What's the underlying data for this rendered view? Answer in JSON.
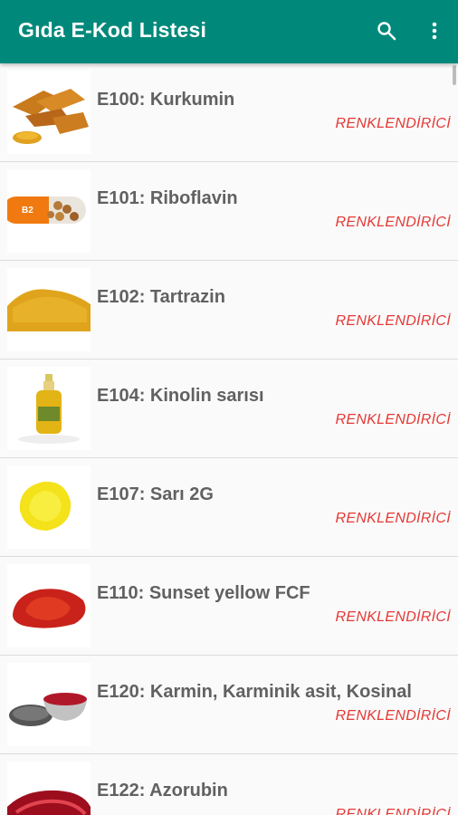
{
  "appbar": {
    "title": "Gıda E-Kod Listesi",
    "accent": "#00897b",
    "icons": [
      "search-icon",
      "overflow-menu-icon"
    ]
  },
  "items": [
    {
      "name": "E100: Kurkumin",
      "category": "RENKLENDİRİCİ"
    },
    {
      "name": "E101: Riboflavin",
      "category": "RENKLENDİRİCİ"
    },
    {
      "name": "E102: Tartrazin",
      "category": "RENKLENDİRİCİ"
    },
    {
      "name": "E104: Kinolin sarısı",
      "category": "RENKLENDİRİCİ"
    },
    {
      "name": "E107: Sarı 2G",
      "category": "RENKLENDİRİCİ"
    },
    {
      "name": "E110: Sunset yellow FCF",
      "category": "RENKLENDİRİCİ"
    },
    {
      "name": "E120: Karmin, Karminik asit, Kosinal",
      "category": "RENKLENDİRİCİ"
    },
    {
      "name": "E122: Azorubin",
      "category": "RENKLENDİRİCİ"
    }
  ],
  "colors": {
    "category_text": "#e53935",
    "name_text": "#616161"
  }
}
